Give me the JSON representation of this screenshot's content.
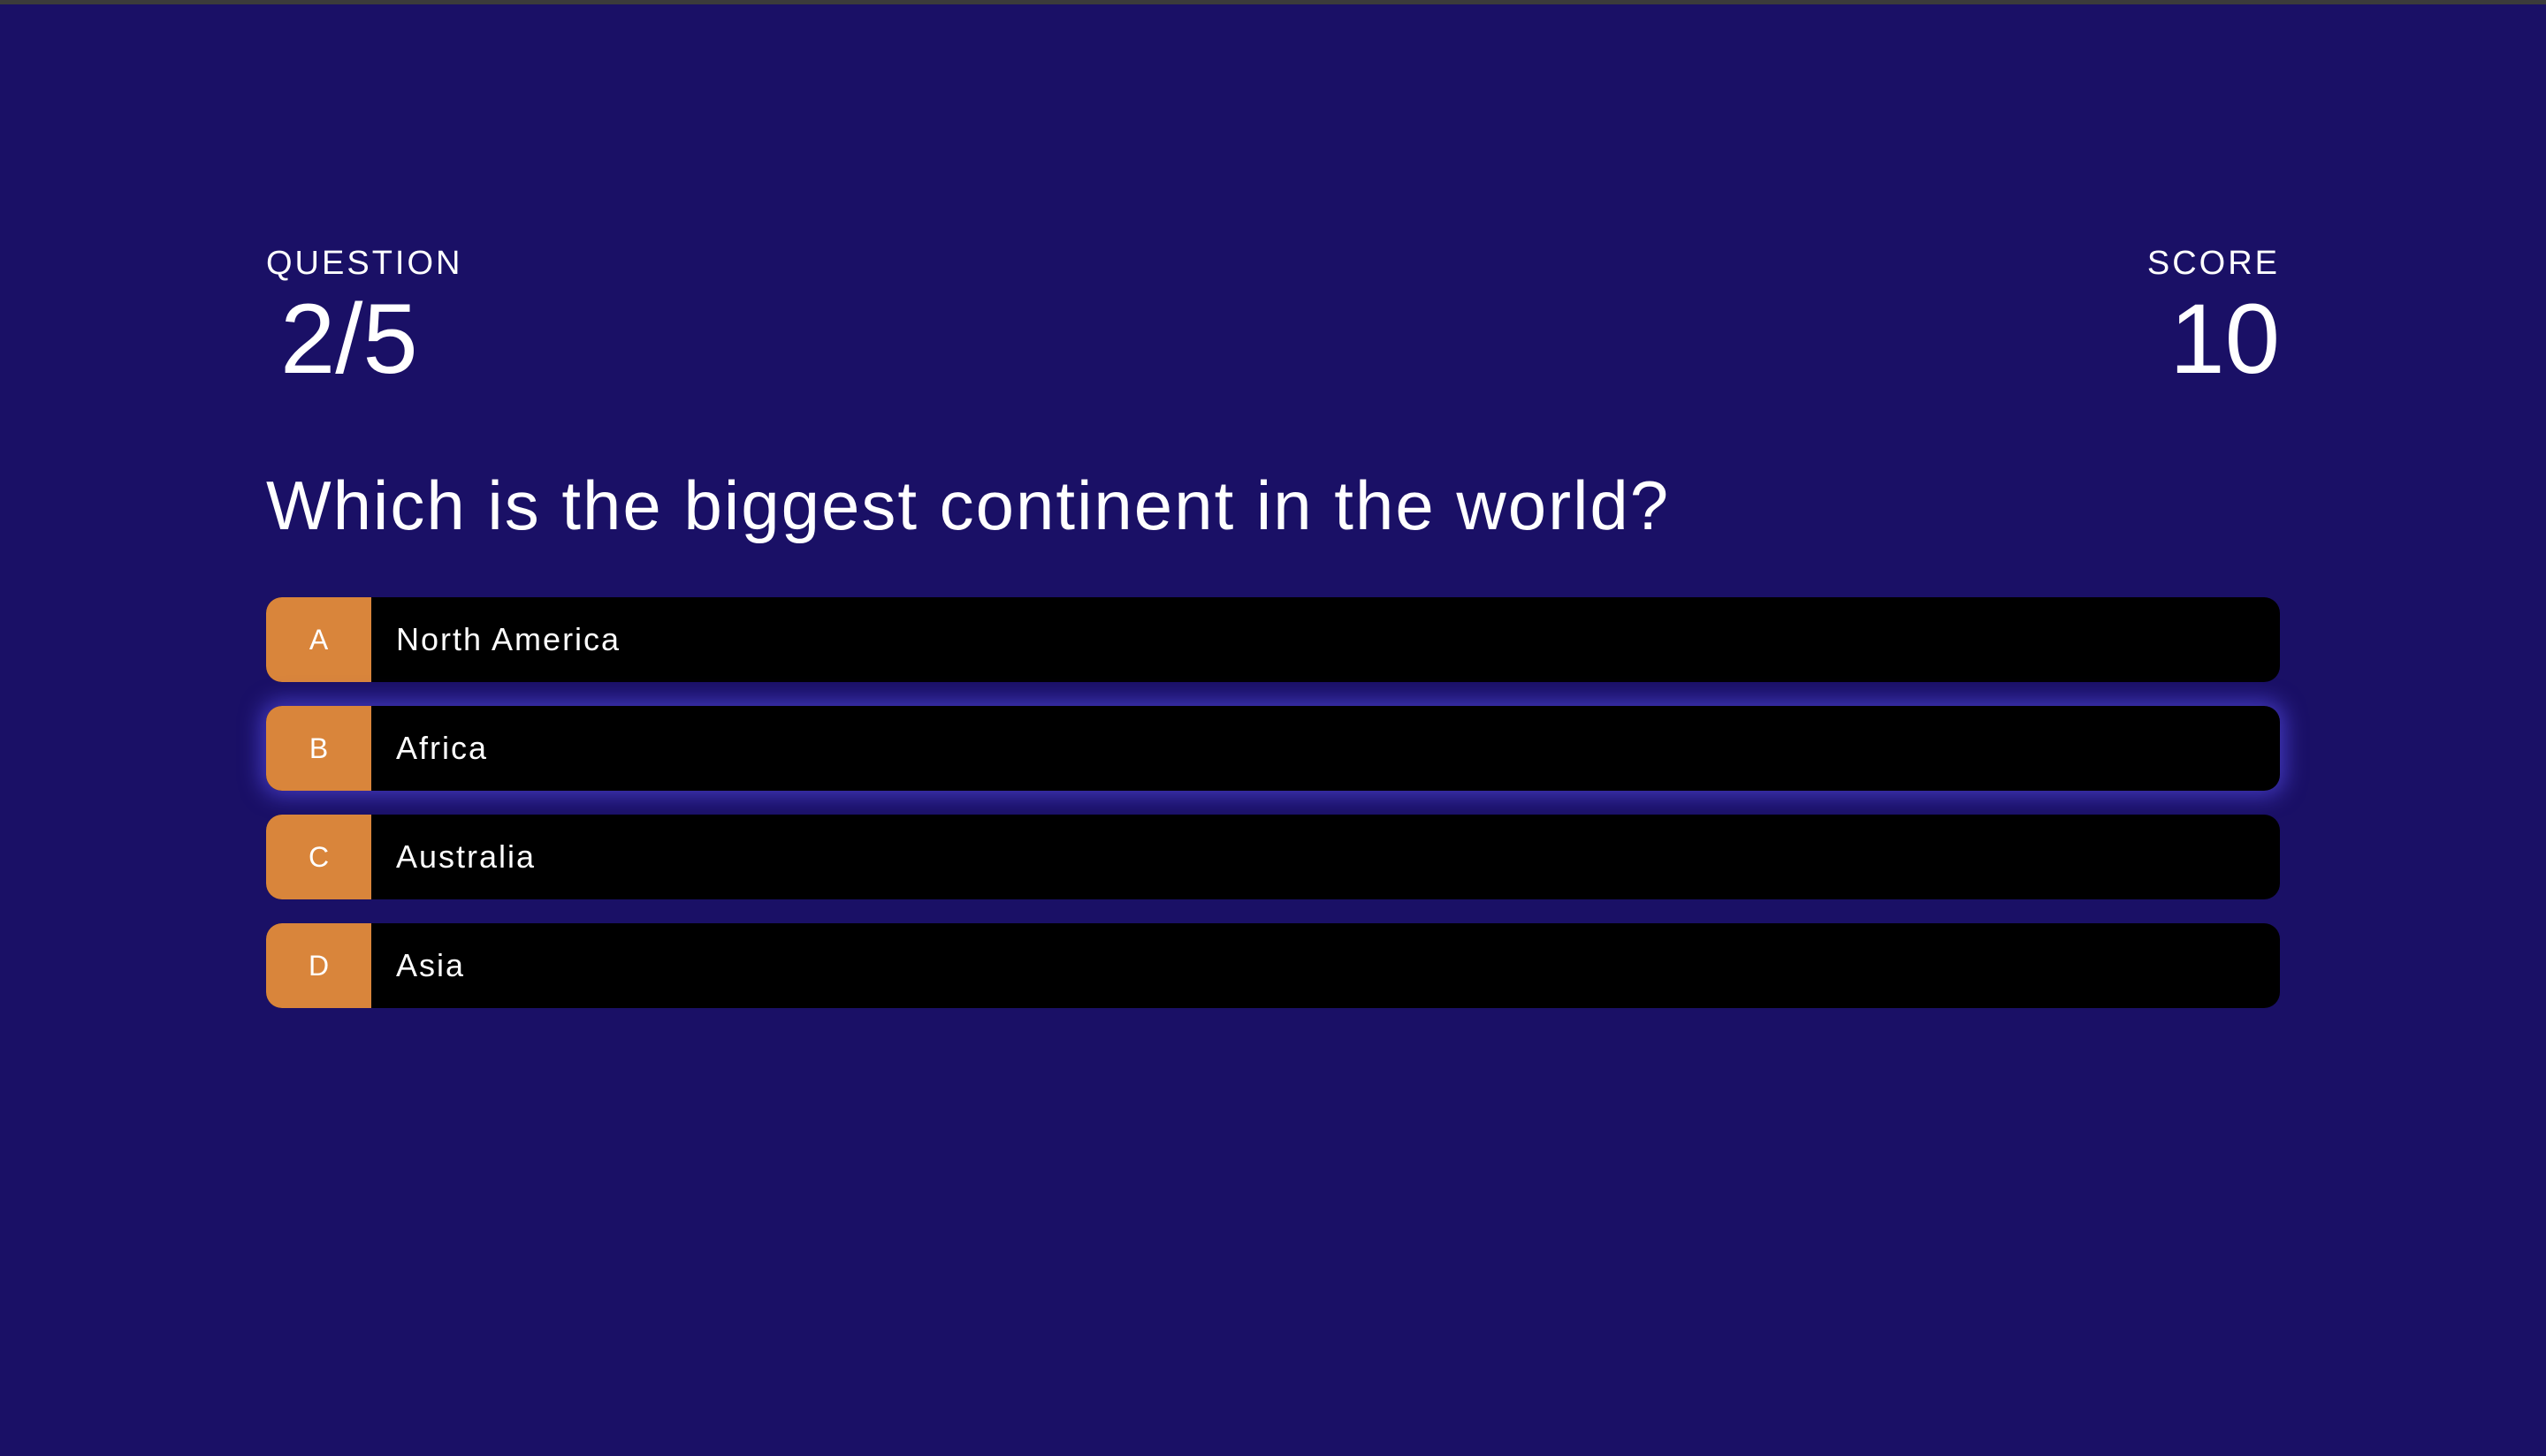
{
  "hud": {
    "question_label": "QUESTION",
    "question_progress": "2/5",
    "score_label": "SCORE",
    "score_value": "10"
  },
  "question": {
    "text": "Which is the biggest continent in the world?"
  },
  "options": [
    {
      "key": "A",
      "label": "North America"
    },
    {
      "key": "B",
      "label": "Africa"
    },
    {
      "key": "C",
      "label": "Australia"
    },
    {
      "key": "D",
      "label": "Asia"
    }
  ],
  "focused_option": "B",
  "colors": {
    "background": "#1a1066",
    "option_background": "#000000",
    "key_background": "#d9853b",
    "focus_glow": "#6058ff"
  }
}
